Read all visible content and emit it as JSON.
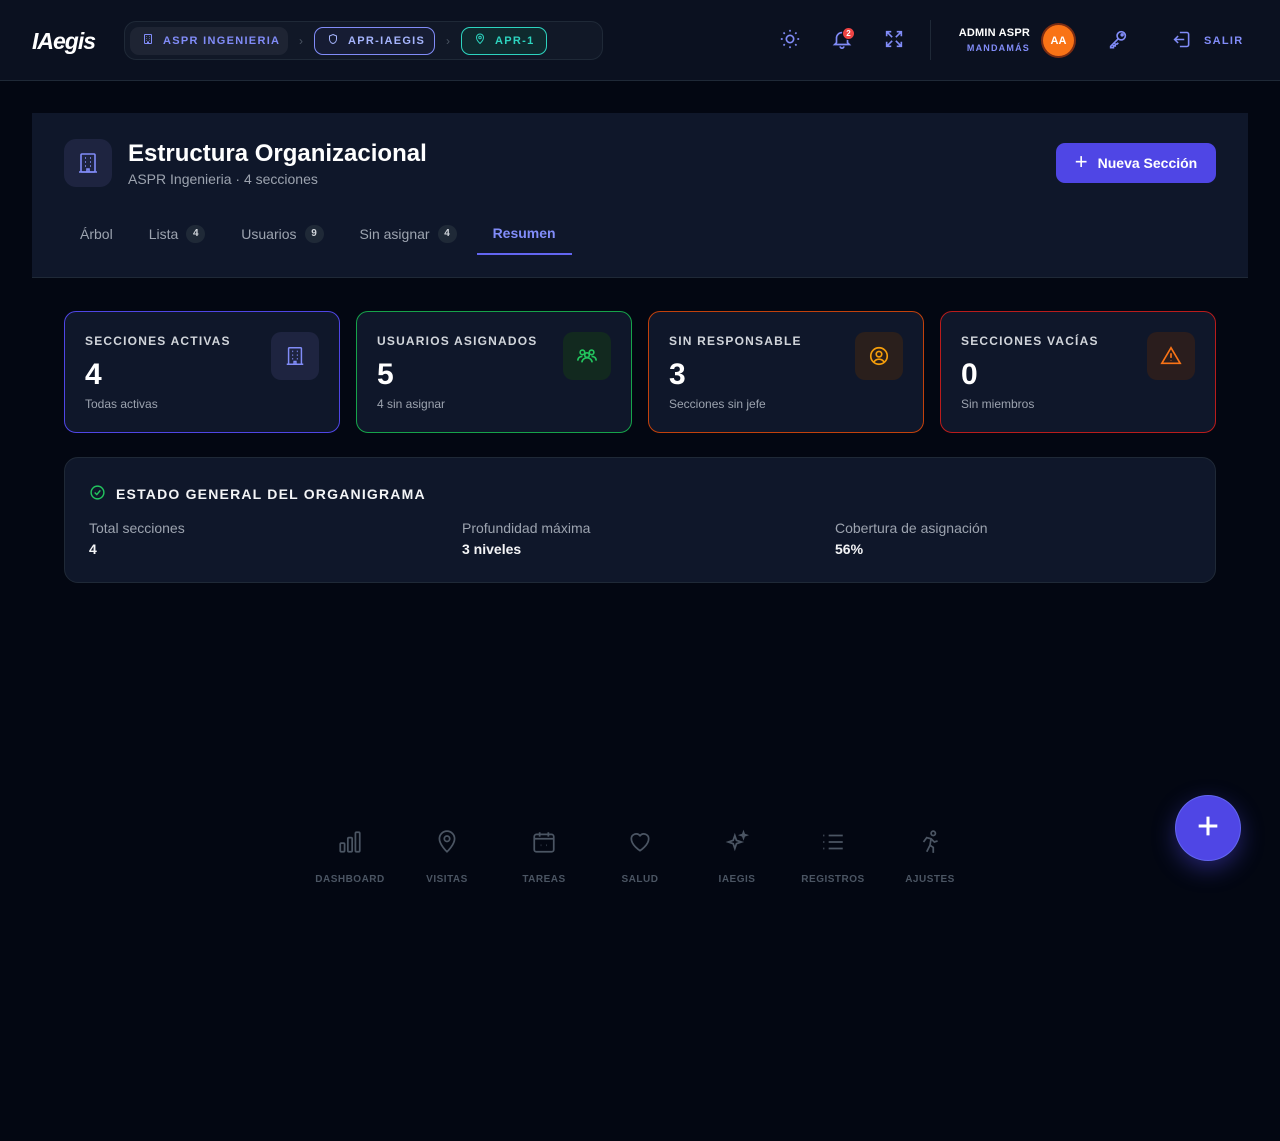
{
  "app": {
    "logo": "IAegis"
  },
  "breadcrumb": {
    "org": "ASPR INGENIERIA",
    "project": "APR-IAEGIS",
    "location": "APR-1"
  },
  "header": {
    "notification_count": "2",
    "user_name": "ADMIN ASPR",
    "user_role": "MANDAMÁS",
    "avatar_initials": "AA",
    "logout_label": "SALIR",
    "icons": [
      "sun-icon",
      "bell-icon",
      "expand-icon",
      "key-icon",
      "logout-icon"
    ]
  },
  "page": {
    "title": "Estructura Organizacional",
    "subtitle": "ASPR Ingenieria · 4 secciones",
    "new_button": "Nueva Sección",
    "tabs": [
      {
        "label": "Árbol",
        "count": null
      },
      {
        "label": "Lista",
        "count": "4"
      },
      {
        "label": "Usuarios",
        "count": "9"
      },
      {
        "label": "Sin asignar",
        "count": "4"
      },
      {
        "label": "Resumen",
        "count": null,
        "active": true
      }
    ]
  },
  "stats": [
    {
      "label": "SECCIONES ACTIVAS",
      "value": "4",
      "sub": "Todas activas",
      "icon": "building-icon",
      "color": "#6366f1"
    },
    {
      "label": "USUARIOS ASIGNADOS",
      "value": "5",
      "sub": "4 sin asignar",
      "icon": "users-icon",
      "color": "#22c55e"
    },
    {
      "label": "SIN RESPONSABLE",
      "value": "3",
      "sub": "Secciones sin jefe",
      "icon": "user-circle-icon",
      "color": "#f59e0b"
    },
    {
      "label": "SECCIONES VACÍAS",
      "value": "0",
      "sub": "Sin miembros",
      "icon": "warning-icon",
      "color": "#f97316"
    }
  ],
  "status": {
    "title": "ESTADO GENERAL DEL ORGANIGRAMA",
    "metrics": [
      {
        "label": "Total secciones",
        "value": "4"
      },
      {
        "label": "Profundidad máxima",
        "value": "3 niveles"
      },
      {
        "label": "Cobertura de asignación",
        "value": "56%"
      }
    ]
  },
  "bottom_nav": [
    {
      "label": "DASHBOARD",
      "icon": "bar-chart-icon"
    },
    {
      "label": "VISITAS",
      "icon": "map-pin-icon"
    },
    {
      "label": "TAREAS",
      "icon": "calendar-icon"
    },
    {
      "label": "SALUD",
      "icon": "heart-icon"
    },
    {
      "label": "IAEGIS",
      "icon": "sparkles-icon"
    },
    {
      "label": "REGISTROS",
      "icon": "list-icon"
    },
    {
      "label": "AJUSTES",
      "icon": "runner-icon"
    }
  ],
  "colors": {
    "accent": "#4f46e5",
    "background": "#030712",
    "panel": "#0f172a"
  }
}
